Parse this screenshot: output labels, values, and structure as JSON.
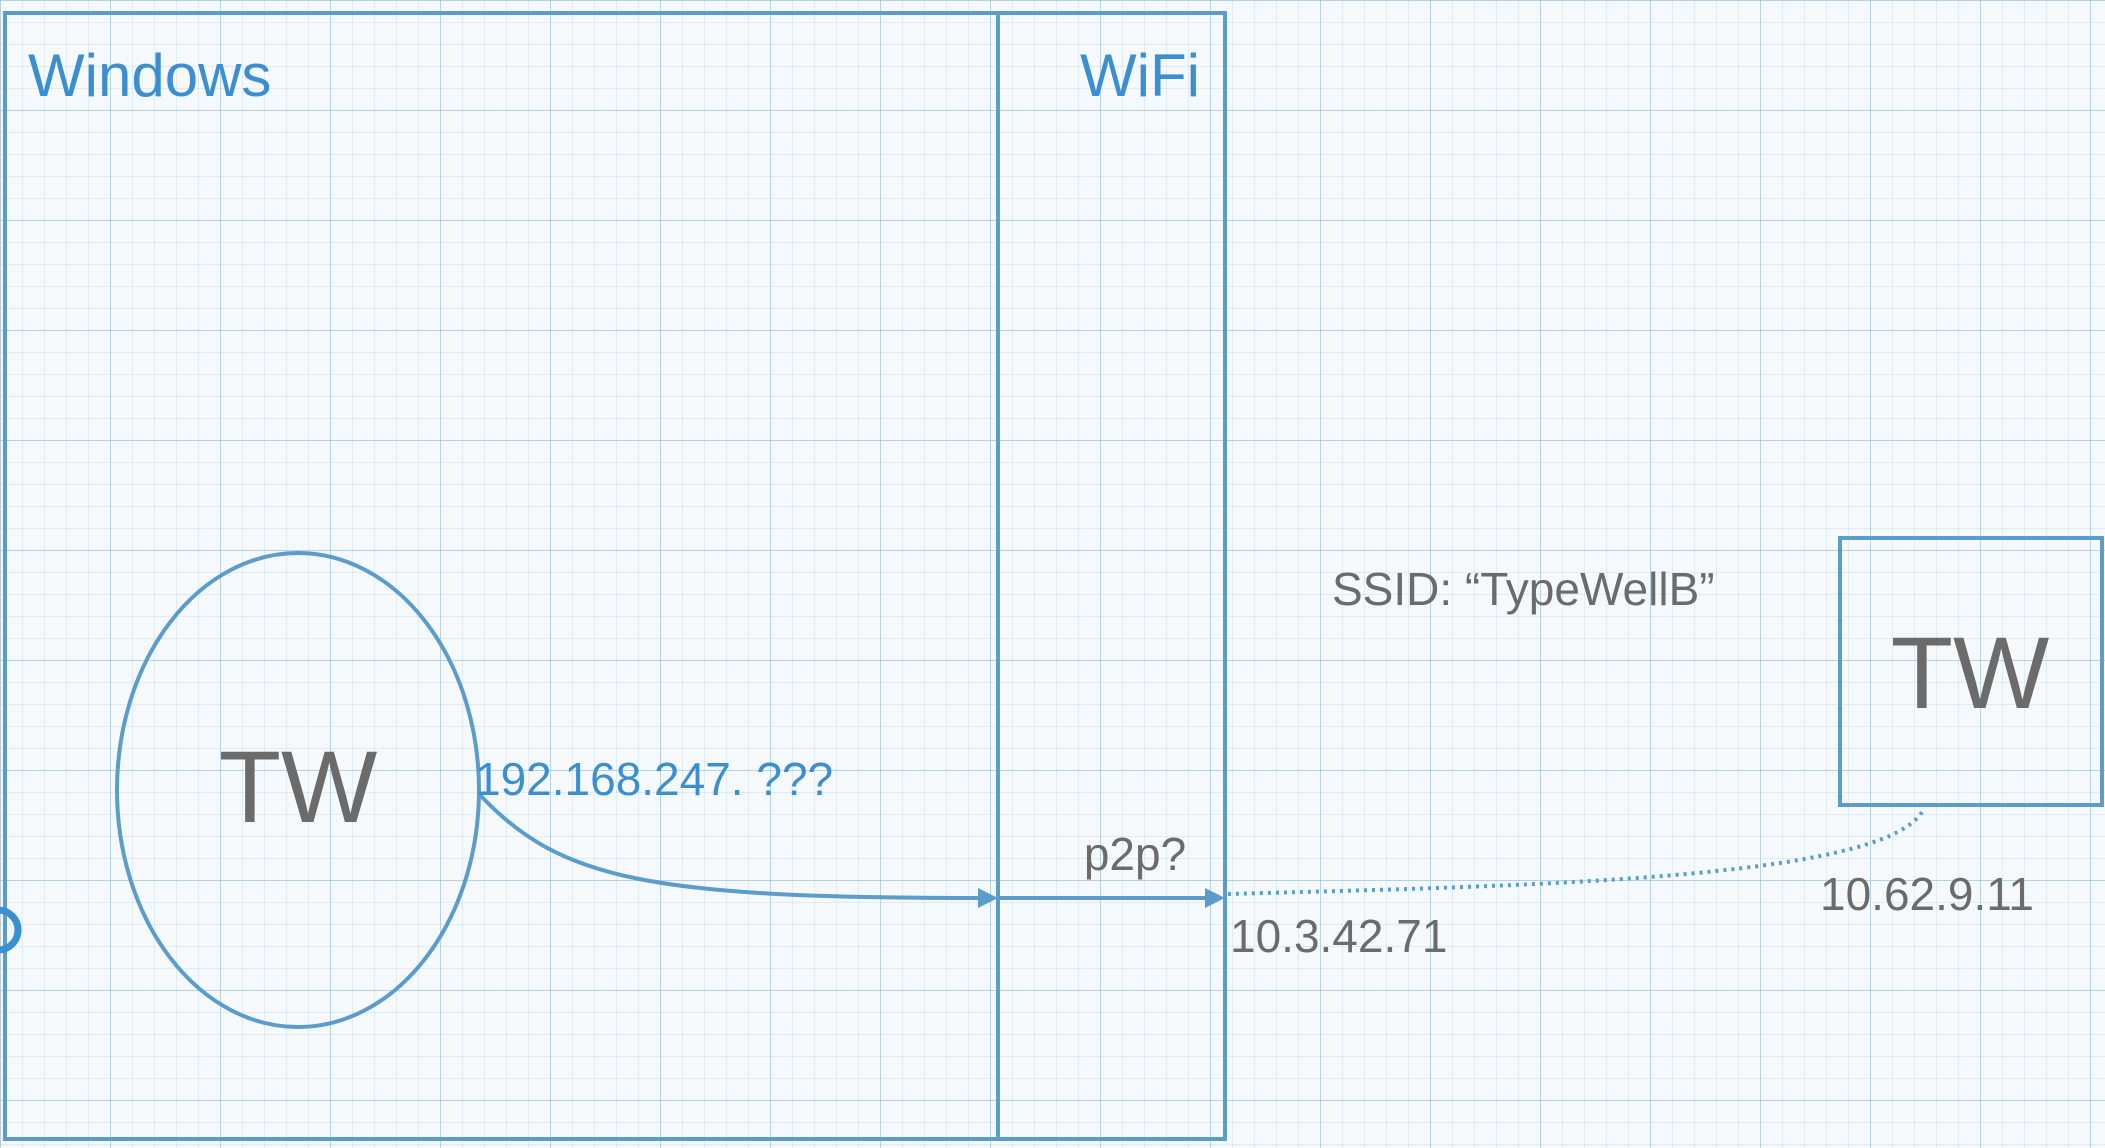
{
  "diagram": {
    "windows_label": "Windows",
    "wifi_label": "WiFi",
    "local_node_label": "TW",
    "remote_node_label": "TW",
    "local_ip": "192.168.247. ???",
    "link_label": "p2p?",
    "wifi_ip": "10.3.42.71",
    "ssid_label": "SSID: “TypeWellB”",
    "remote_ip": "10.62.9.11"
  },
  "colors": {
    "line": "#5b9ccb",
    "blue_text": "#3b8fd0",
    "gray_text": "#6b6b6b",
    "background": "#f6f9fb"
  }
}
